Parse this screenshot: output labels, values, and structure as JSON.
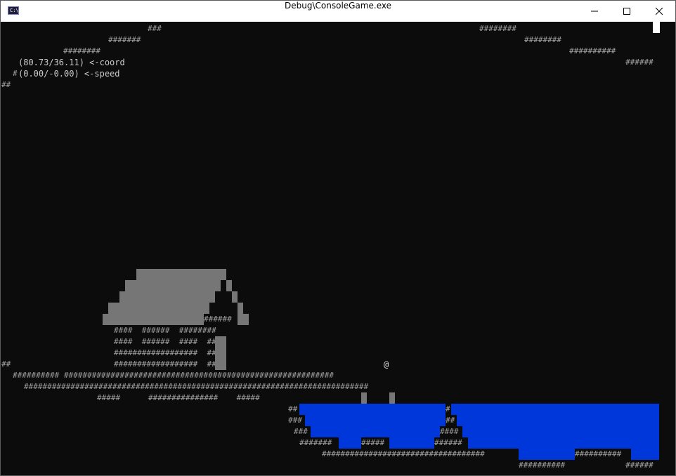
{
  "window": {
    "title": "Debug\\ConsoleGame.exe",
    "app_icon_text": "C:\\"
  },
  "hud": {
    "coord": "(80.73/36.11) <-coord",
    "speed": "(0.00/-0.00) <-speed"
  },
  "player": "@",
  "colors": {
    "water": "#0037da",
    "wall": "#767676",
    "background": "#0c0c0c"
  }
}
